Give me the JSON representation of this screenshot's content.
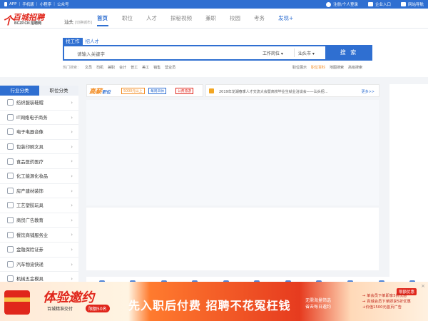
{
  "topbar": {
    "app": "APP",
    "mobile": "手机版",
    "mini": "小程序",
    "official": "公众号",
    "login": "注册/个人登录",
    "enterprise": "企业入口",
    "nav": "网站导航"
  },
  "logo": {
    "mark": "个",
    "brand": "百城招聘",
    "domain": "BCZP.CN 招聘网"
  },
  "city": {
    "name": "汕头",
    "switch": "[切换城市]"
  },
  "nav": {
    "home": "首页",
    "jobs": "职位",
    "talent": "人才",
    "explore": "探秘视频",
    "part": "兼职",
    "campus": "校园",
    "exam": "考务",
    "discover": "发现+"
  },
  "search": {
    "tab_job": "找工作",
    "tab_talent": "招人才",
    "placeholder": "请输入关键字",
    "job_type": "工作岗位",
    "city": "汕头市",
    "button": "搜 索"
  },
  "hot": {
    "label": "热门搜索：",
    "items": [
      "文员",
      "司机",
      "兼职",
      "会计",
      "普工",
      "美工",
      "销售",
      "营业员"
    ]
  },
  "hot_right": {
    "a": "职位展示",
    "b": "职位百科",
    "c": "地图搜索",
    "d": "高级搜索"
  },
  "sidebar": {
    "tab_industry": "行业分类",
    "tab_position": "职位分类",
    "cats": [
      "纺织服装鞋帽",
      "IT网络电子商务",
      "电子电器音像",
      "包装印刷文具",
      "食品医药医疗",
      "化工能源化妆品",
      "房产建材装饰",
      "工艺塑胶玩具",
      "商贸广告教育",
      "餐饮商铺服务业",
      "金融保险证券",
      "汽车物流快递",
      "机械五金模具"
    ]
  },
  "banner": {
    "brand": "高薪",
    "brand_sub": "职位",
    "tag1": "5000元以上",
    "tag2": "每周四休",
    "tag3": "公费旅游"
  },
  "notice": {
    "text": "2019年龙湖春季人才交流大会暨高校毕业生就业洽谈会——汕头招...",
    "more": "更多>>"
  },
  "bottom": {
    "title": "体验邀约",
    "sub": "百城精准交付",
    "quota": "限额50名",
    "slogan": "先入职后付费  招聘不花冤枉钱",
    "small1": "无需海量筛选",
    "small2": "省去每日邀约",
    "tag": "限额优惠",
    "promo1": "→ 单会员下单即享5折优惠",
    "promo2": "→ 百城会员下单即享5折优惠",
    "promo3": "+价值1500元首页广告",
    "close": "×"
  }
}
